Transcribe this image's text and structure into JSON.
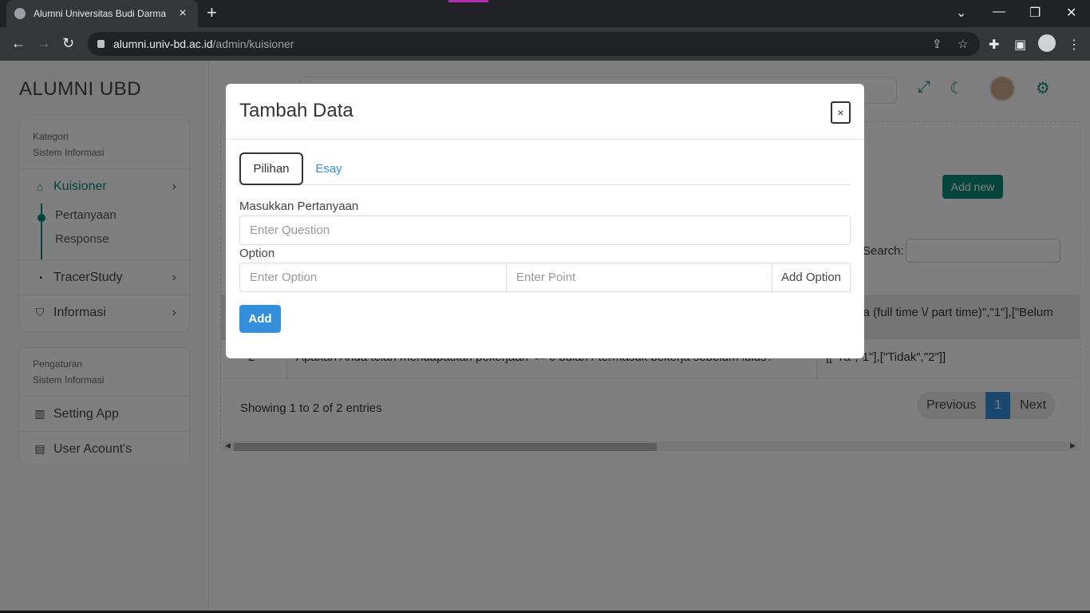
{
  "browser": {
    "tab_title": "Alumni Universitas Budi Darma",
    "url_host": "alumni.univ-bd.ac.id",
    "url_path": "/admin/kuisioner"
  },
  "sidebar": {
    "brand": "ALUMNI UBD",
    "group1": {
      "category": "Kategori",
      "subcategory": "Sistem Informasi",
      "items": [
        {
          "label": "Kuisioner",
          "icon": "home-icon"
        },
        {
          "label": "TracerStudy",
          "icon": "gauge-icon"
        },
        {
          "label": "Informasi",
          "icon": "shield-icon"
        }
      ],
      "submenu": [
        "Pertanyaan",
        "Response"
      ]
    },
    "group2": {
      "category": "Pengaturan",
      "subcategory": "Sistem Informasi",
      "items": [
        {
          "label": "Setting App",
          "icon": "panel-icon"
        },
        {
          "label": "User Acount's",
          "icon": "clipboard-icon"
        }
      ]
    }
  },
  "content": {
    "add_new": "Add new",
    "search_label": "Search:",
    "row1_options": "erja (full time \\/ part time)\",\"1\"],[\"Belum",
    "row2": {
      "no": "2",
      "question": "Apakah Anda telah mendapatkan pekerjaan <= 6 bulan / termasuk bekerja sebelum lulus?",
      "options": "[[\"Ya\",\"1\"],[\"Tidak\",\"2\"]]"
    },
    "showing": "Showing 1 to 2 of 2 entries",
    "pager": {
      "prev": "Previous",
      "current": "1",
      "next": "Next"
    }
  },
  "modal": {
    "title": "Tambah Data",
    "close": "×",
    "tabs": [
      "Pilihan",
      "Esay"
    ],
    "question_label": "Masukkan Pertanyaan",
    "question_placeholder": "Enter Question",
    "option_label": "Option",
    "option_placeholder": "Enter Option",
    "point_placeholder": "Enter Point",
    "add_option": "Add Option",
    "add": "Add"
  },
  "colors": {
    "accent": "#0d8a7a",
    "primary": "#3490dc"
  }
}
